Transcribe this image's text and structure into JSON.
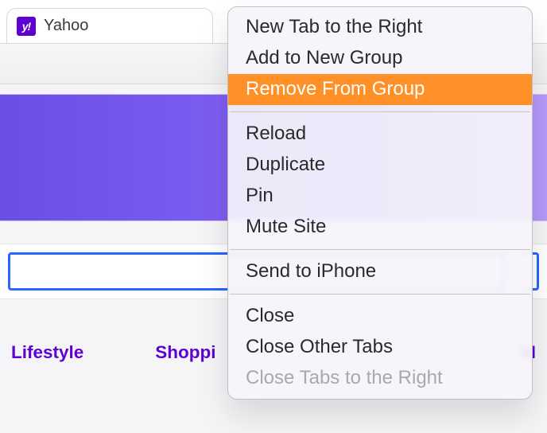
{
  "tab": {
    "favicon_letter": "y!",
    "title": "Yahoo"
  },
  "nav": {
    "items": [
      "Lifestyle",
      "Shoppi",
      "M"
    ]
  },
  "context_menu": {
    "groups": [
      {
        "items": [
          {
            "label": "New Tab to the Right",
            "highlight": false,
            "disabled": false
          },
          {
            "label": "Add to New Group",
            "highlight": false,
            "disabled": false
          },
          {
            "label": "Remove From Group",
            "highlight": true,
            "disabled": false
          }
        ]
      },
      {
        "items": [
          {
            "label": "Reload",
            "highlight": false,
            "disabled": false
          },
          {
            "label": "Duplicate",
            "highlight": false,
            "disabled": false
          },
          {
            "label": "Pin",
            "highlight": false,
            "disabled": false
          },
          {
            "label": "Mute Site",
            "highlight": false,
            "disabled": false
          }
        ]
      },
      {
        "items": [
          {
            "label": "Send to iPhone",
            "highlight": false,
            "disabled": false
          }
        ]
      },
      {
        "items": [
          {
            "label": "Close",
            "highlight": false,
            "disabled": false
          },
          {
            "label": "Close Other Tabs",
            "highlight": false,
            "disabled": false
          },
          {
            "label": "Close Tabs to the Right",
            "highlight": false,
            "disabled": true
          }
        ]
      }
    ]
  }
}
